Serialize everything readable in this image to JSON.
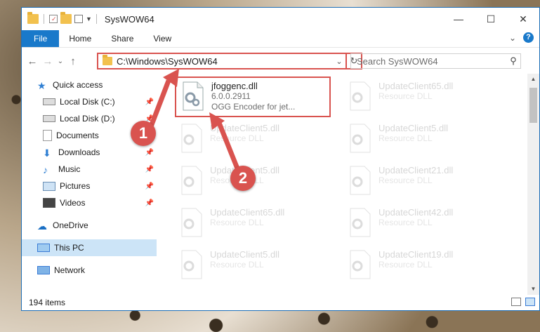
{
  "window": {
    "title": "SysWOW64",
    "controls": {
      "minimize": "—",
      "maximize": "☐",
      "close": "✕"
    }
  },
  "ribbon": {
    "tabs": [
      "File",
      "Home",
      "Share",
      "View"
    ],
    "expand_glyph": "⌄",
    "help_glyph": "?"
  },
  "nav": {
    "back_glyph": "←",
    "forward_glyph": "→",
    "recent_glyph": "⌄",
    "up_glyph": "↑",
    "address": "C:\\Windows\\SysWOW64",
    "address_dropdown": "⌄",
    "refresh_glyph": "↻",
    "search_placeholder": "Search SysWOW64",
    "search_glyph": "⚲"
  },
  "sidebar": {
    "items": [
      {
        "label": "Quick access",
        "icon": "star-icon",
        "pinned": false
      },
      {
        "label": "Local Disk (C:)",
        "icon": "drive-icon",
        "pinned": true
      },
      {
        "label": "Local Disk (D:)",
        "icon": "drive-icon",
        "pinned": true
      },
      {
        "label": "Documents",
        "icon": "documents-icon",
        "pinned": true
      },
      {
        "label": "Downloads",
        "icon": "downloads-icon",
        "pinned": true
      },
      {
        "label": "Music",
        "icon": "music-icon",
        "pinned": true
      },
      {
        "label": "Pictures",
        "icon": "pictures-icon",
        "pinned": true
      },
      {
        "label": "Videos",
        "icon": "videos-icon",
        "pinned": true
      },
      {
        "label": "OneDrive",
        "icon": "onedrive-icon",
        "pinned": false
      },
      {
        "label": "This PC",
        "icon": "pc-icon",
        "pinned": false,
        "selected": true
      },
      {
        "label": "Network",
        "icon": "network-icon",
        "pinned": false
      }
    ],
    "pin_glyph": "📌"
  },
  "files": [
    {
      "name": "jfoggenc.dll",
      "line2": "6.0.0.2911",
      "line3": "OGG Encoder for jet...",
      "highlighted": true
    },
    {
      "name": "UpdateClient65.dll",
      "line2": "Resource DLL"
    },
    {
      "name": "UpdateClient5.dll",
      "line2": "Resource DLL"
    },
    {
      "name": "UpdateClient5.dll",
      "line2": "Resource DLL"
    },
    {
      "name": "UpdateClient5.dll",
      "line2": "Resource DLL"
    },
    {
      "name": "UpdateClient21.dll",
      "line2": "Resource DLL"
    },
    {
      "name": "UpdateClient65.dll",
      "line2": "Resource DLL"
    },
    {
      "name": "UpdateClient42.dll",
      "line2": "Resource DLL"
    },
    {
      "name": "UpdateClient5.dll",
      "line2": "Resource DLL"
    },
    {
      "name": "UpdateClient19.dll",
      "line2": "Resource DLL"
    }
  ],
  "status": {
    "items_count": "194 items"
  },
  "callouts": [
    "1",
    "2"
  ],
  "colors": {
    "accent": "#1979ca",
    "callout": "#d9534f",
    "selection": "#cce4f7"
  }
}
